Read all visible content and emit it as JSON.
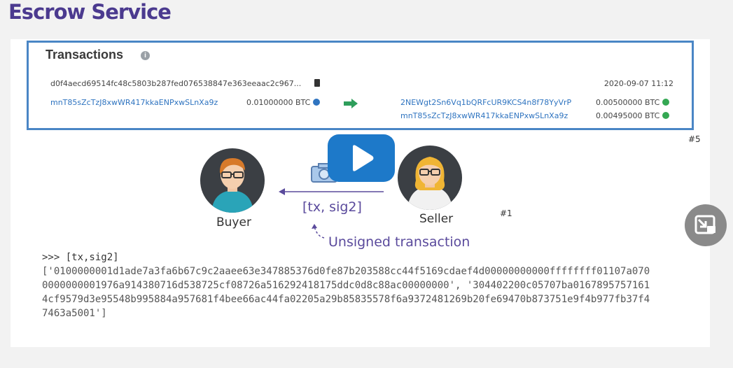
{
  "page": {
    "title": "Escrow Service"
  },
  "transactions_panel": {
    "heading": "Transactions",
    "tx_hash": "d0f4aecd69514fc48c5803b287fed076538847e363eeaac2c967...",
    "date": "2020-09-07 11:12",
    "input": {
      "address": "mnT85sZcTzJ8xwWR417kkaENPxwSLnXa9z",
      "amount": "0.01000000 BTC"
    },
    "outputs": [
      {
        "address": "2NEWgt2Sn6Vq1bQRFcUR9KCS4n8f78YyVrP",
        "amount": "0.00500000 BTC"
      },
      {
        "address": "mnT85sZcTzJ8xwWR417kkaENPxwSLnXa9z",
        "amount": "0.00495000 BTC"
      }
    ]
  },
  "diagram": {
    "tag_5": "#5",
    "tag_1": "#1",
    "buyer_label": "Buyer",
    "seller_label": "Seller",
    "sig_label": "[tx, sig2]",
    "unsigned_label": "Unsigned transaction"
  },
  "code": {
    "prompt": ">>> [tx,sig2]",
    "line1": "['0100000001d1ade7a3fa6b67c9c2aaee63e347885376d0fe87b203588cc44f5169cdaef4d00000000000ffffffff01107a070",
    "line2": "0000000001976a914380716d538725cf08726a516292418175ddc0d8c88ac00000000', '304402200c05707ba0167895757161",
    "line3": "4cf9579d3e95548b995884a957681f4bee66ac44fa02205a29b85835578f6a9372481269b20fe69470b873751e9f4b977fb37f4",
    "line4": "7463a5001']"
  },
  "icons": {
    "info": "info-icon",
    "copy": "copy-icon",
    "globe": "globe-icon",
    "arrow": "arrow-right-icon",
    "play": "play-icon",
    "camera": "camera-icon",
    "pip": "picture-in-picture-icon"
  },
  "colors": {
    "title": "#4b3a8f",
    "panel_border": "#4a86c5",
    "link": "#2f74c0",
    "play": "#1d79c9"
  }
}
